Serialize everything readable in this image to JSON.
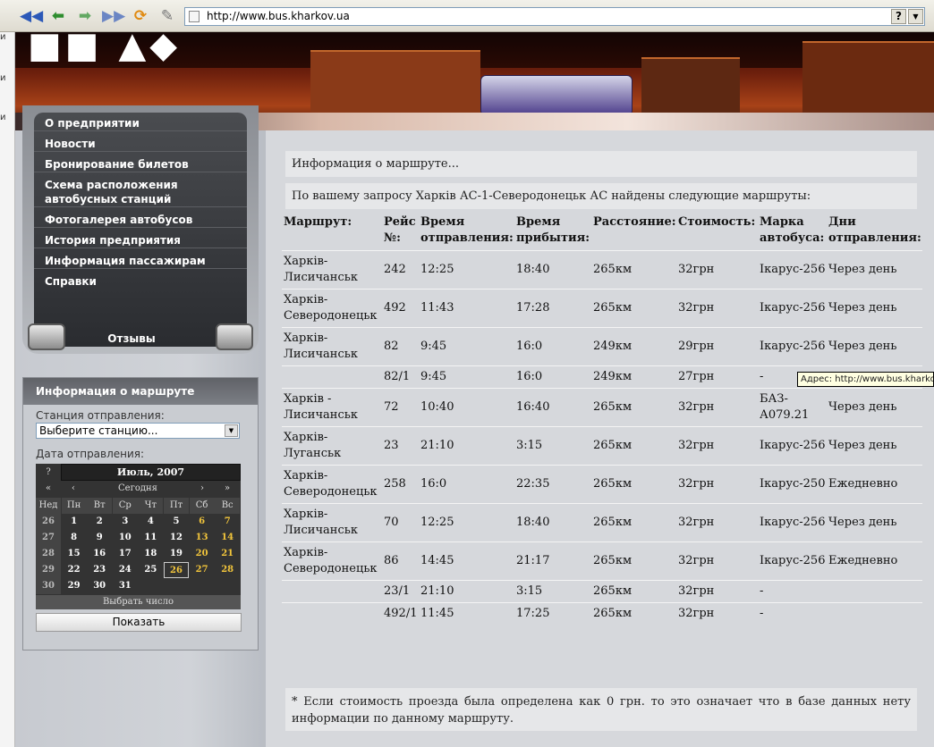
{
  "browser": {
    "url": "http://www.bus.kharkov.ua",
    "help_label": "?",
    "tooltip": "Адрес: http://www.bus.kharkov.ua",
    "left_strip_letters": [
      "и",
      "и",
      "и"
    ]
  },
  "colors": {
    "menu_bg": "#2a2c30",
    "weekend": "#f2c53b",
    "info_bg": "#e6e7e9"
  },
  "menu": {
    "items": [
      "О предприятии",
      "Новости",
      "Бронирование билетов",
      "Схема расположения автобусных станций",
      "Фотогалерея автобусов",
      "История предприятия",
      "Информация пассажирам",
      "Справки"
    ],
    "reviews": "Отзывы"
  },
  "route_form": {
    "title": "Информация о маршруте",
    "station_label": "Станция отправления:",
    "station_value": "Выберите станцию...",
    "date_label": "Дата отправления:",
    "show_button": "Показать"
  },
  "calendar": {
    "help": "?",
    "month": "Июль, 2007",
    "nav_prev_year": "«",
    "nav_prev": "‹",
    "today": "Сегодня",
    "nav_next": "›",
    "nav_next_year": "»",
    "dow": [
      "Нед",
      "Пн",
      "Вт",
      "Ср",
      "Чт",
      "Пт",
      "Сб",
      "Вс"
    ],
    "weeks": [
      {
        "wk": "26",
        "days": [
          "1",
          "2",
          "3",
          "4",
          "5",
          "6",
          "7"
        ]
      },
      {
        "wk": "27",
        "days": [
          "8",
          "9",
          "10",
          "11",
          "12",
          "13",
          "14"
        ]
      },
      {
        "wk": "28",
        "days": [
          "15",
          "16",
          "17",
          "18",
          "19",
          "20",
          "21"
        ]
      },
      {
        "wk": "29",
        "days": [
          "22",
          "23",
          "24",
          "25",
          "26",
          "27",
          "28"
        ]
      },
      {
        "wk": "30",
        "days": [
          "29",
          "30",
          "31",
          "",
          "",
          "",
          ""
        ]
      }
    ],
    "selected_day": "26",
    "footer": "Выбрать число"
  },
  "main": {
    "info_title": "Информация о маршруте...",
    "query_result": "По вашему запросу Харків АС-1-Северодонецьк АС найдены следующие маршруты:",
    "columns": [
      "Маршрут:",
      "Рейс №:",
      "Время отправления:",
      "Время прибытия:",
      "Расстояние:",
      "Стоимость:",
      "Марка автобуса:",
      "Дни отправления:"
    ],
    "rows": [
      [
        "Харків-Лисичанськ",
        "242",
        "12:25",
        "18:40",
        "265км",
        "32грн",
        "Ікарус-256",
        "Через день"
      ],
      [
        "Харків-Северодонецьк",
        "492",
        "11:43",
        "17:28",
        "265км",
        "32грн",
        "Ікарус-256",
        "Через день"
      ],
      [
        "Харків-Лисичанськ",
        "82",
        "9:45",
        "16:0",
        "249км",
        "29грн",
        "Ікарус-256",
        "Через день"
      ],
      [
        "",
        "82/1",
        "9:45",
        "16:0",
        "249км",
        "27грн",
        "-",
        ""
      ],
      [
        "Харків - Лисичанськ",
        "72",
        "10:40",
        "16:40",
        "265км",
        "32грн",
        "БАЗ-А079.21",
        "Через день"
      ],
      [
        "Харків-Луганськ",
        "23",
        "21:10",
        "3:15",
        "265км",
        "32грн",
        "Ікарус-256",
        "Через день"
      ],
      [
        "Харків-Северодонецьк",
        "258",
        "16:0",
        "22:35",
        "265км",
        "32грн",
        "Ікарус-250",
        "Ежедневно"
      ],
      [
        "Харків-Лисичанськ",
        "70",
        "12:25",
        "18:40",
        "265км",
        "32грн",
        "Ікарус-256",
        "Через день"
      ],
      [
        "Харків-Северодонецьк",
        "86",
        "14:45",
        "21:17",
        "265км",
        "32грн",
        "Ікарус-256",
        "Ежедневно"
      ],
      [
        "",
        "23/1",
        "21:10",
        "3:15",
        "265км",
        "32грн",
        "-",
        ""
      ],
      [
        "",
        "492/1",
        "11:45",
        "17:25",
        "265км",
        "32грн",
        "-",
        ""
      ]
    ],
    "note": "* Если стоимость проезда была определена как 0 грн. то это означает что в базе данных нету информации по данному маршруту."
  }
}
